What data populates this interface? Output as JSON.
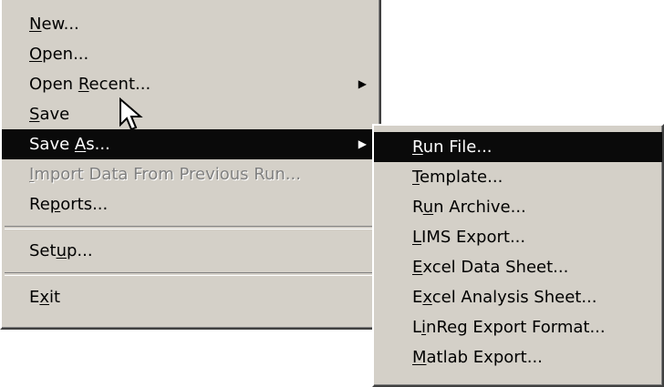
{
  "main_menu": {
    "items": [
      {
        "pre": "",
        "key": "N",
        "post": "ew..."
      },
      {
        "pre": "",
        "key": "O",
        "post": "pen..."
      },
      {
        "pre": "Open ",
        "key": "R",
        "post": "ecent..."
      },
      {
        "pre": "",
        "key": "S",
        "post": "ave"
      },
      {
        "pre": "Save ",
        "key": "A",
        "post": "s..."
      },
      {
        "pre": "",
        "key": "I",
        "post": "mport Data From Previous Run..."
      },
      {
        "pre": "Re",
        "key": "p",
        "post": "orts..."
      },
      {
        "pre": "Set",
        "key": "u",
        "post": "p..."
      },
      {
        "pre": "E",
        "key": "x",
        "post": "it"
      }
    ],
    "submenu_arrow": "▶"
  },
  "save_as_submenu": {
    "items": [
      {
        "pre": "",
        "key": "R",
        "post": "un File..."
      },
      {
        "pre": "",
        "key": "T",
        "post": "emplate..."
      },
      {
        "pre": "R",
        "key": "u",
        "post": "n Archive..."
      },
      {
        "pre": "",
        "key": "L",
        "post": "IMS Export..."
      },
      {
        "pre": "",
        "key": "E",
        "post": "xcel Data Sheet..."
      },
      {
        "pre": "E",
        "key": "x",
        "post": "cel Analysis Sheet..."
      },
      {
        "pre": "L",
        "key": "i",
        "post": "nReg Export Format..."
      },
      {
        "pre": "",
        "key": "M",
        "post": "atlab Export..."
      }
    ]
  },
  "state": {
    "highlighted_main": "Save As...",
    "highlighted_sub": "Run File...",
    "disabled": "Import Data From Previous Run..."
  },
  "colors": {
    "menu_bg": "#d4d0c8",
    "highlight_bg": "#0a0a0a",
    "highlight_text": "#ffffff",
    "disabled_text": "#808080"
  },
  "cursor": "arrow-pointer-icon"
}
